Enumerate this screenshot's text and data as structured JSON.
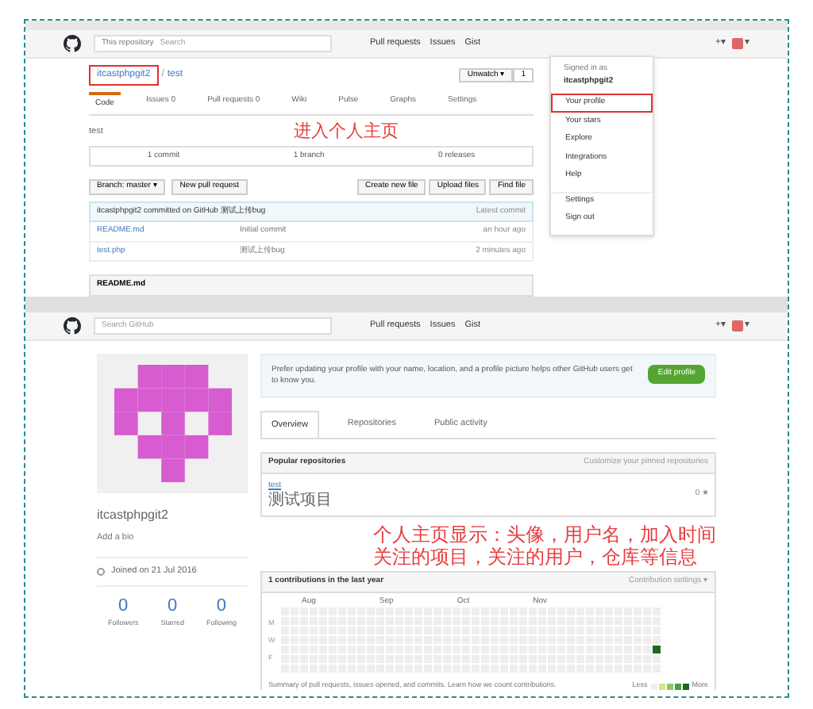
{
  "top": {
    "header": {
      "search_scope": "This repository",
      "search_placeholder": "Search",
      "nav": [
        "Pull requests",
        "Issues",
        "Gist"
      ],
      "new_menu": "+▾",
      "avatar_caret": "▾"
    },
    "repo_owner": "itcastphpgit2",
    "repo_sep": "/",
    "repo_name": "test",
    "unwatch": "Unwatch ▾",
    "unwatch_count": "1",
    "tabs": [
      {
        "label": "Code",
        "selected": true
      },
      {
        "label": "Issues 0",
        "selected": false
      },
      {
        "label": "Pull requests 0",
        "selected": false
      },
      {
        "label": "Wiki",
        "selected": false
      },
      {
        "label": "Pulse",
        "selected": false
      },
      {
        "label": "Graphs",
        "selected": false
      },
      {
        "label": "Settings",
        "selected": false
      }
    ],
    "description": "test",
    "stats": [
      "1 commit",
      "1 branch",
      "0 releases"
    ],
    "branch_button": "Branch: master ▾",
    "pull_button": "New pull request",
    "file_buttons": [
      "Create new file",
      "Upload files",
      "Find file"
    ],
    "commit_line": "itcastphpgit2 committed on GitHub 测试上传bug",
    "latest_commit": "Latest commit",
    "files": [
      {
        "name": "README.md",
        "message": "Initial commit",
        "age": "an hour ago"
      },
      {
        "name": "test.php",
        "message": "测试上传bug",
        "age": "2 minutes ago"
      }
    ],
    "readme_title": "README.md",
    "dropdown": {
      "signed_in": "Signed in as",
      "user": "itcastphpgit2",
      "items": [
        {
          "label": "Your profile",
          "highlighted": true
        },
        {
          "label": "Your stars",
          "highlighted": false
        },
        {
          "label": "Explore",
          "highlighted": false
        },
        {
          "label": "Integrations",
          "highlighted": false
        },
        {
          "label": "Help",
          "highlighted": false
        },
        {
          "label": "Settings",
          "highlighted": false
        },
        {
          "label": "Sign out",
          "highlighted": false
        }
      ]
    },
    "annotation": "进入个人主页"
  },
  "bottom": {
    "header": {
      "search_placeholder": "Search GitHub",
      "nav": [
        "Pull requests",
        "Issues",
        "Gist"
      ],
      "new_menu": "+▾",
      "avatar_caret": "▾"
    },
    "username": "itcastphpgit2",
    "bio": "Add a bio",
    "joined": "Joined on 21 Jul 2016",
    "counts": [
      {
        "value": "0",
        "label": "Followers"
      },
      {
        "value": "0",
        "label": "Starred"
      },
      {
        "value": "0",
        "label": "Following"
      }
    ],
    "banner": "Prefer updating your profile with your name, location, and a profile picture helps other GitHub users get to know you.",
    "edit_button": "Edit profile",
    "tabs": [
      {
        "label": "Overview",
        "selected": true
      },
      {
        "label": "Repositories",
        "selected": false
      },
      {
        "label": "Public activity",
        "selected": false
      }
    ],
    "popular_title": "Popular repositories",
    "customize": "Customize your pinned repositories",
    "repo": {
      "name": "test",
      "description": "测试项目",
      "stars": "0 ★"
    },
    "contrib_title": "1 contributions in the last year",
    "contrib_settings": "Contribution settings ▾",
    "months": [
      "Aug",
      "Sep",
      "Oct",
      "Nov"
    ],
    "days": [
      "M",
      "W",
      "F"
    ],
    "summary": "Summary of pull requests, issues opened, and commits. Learn how we count contributions.",
    "less": "Less",
    "more": "More",
    "annotation_lines": [
      "个人主页显示：头像，用户名，加入时间",
      "关注的项目，关注的用户，仓库等信息"
    ]
  }
}
